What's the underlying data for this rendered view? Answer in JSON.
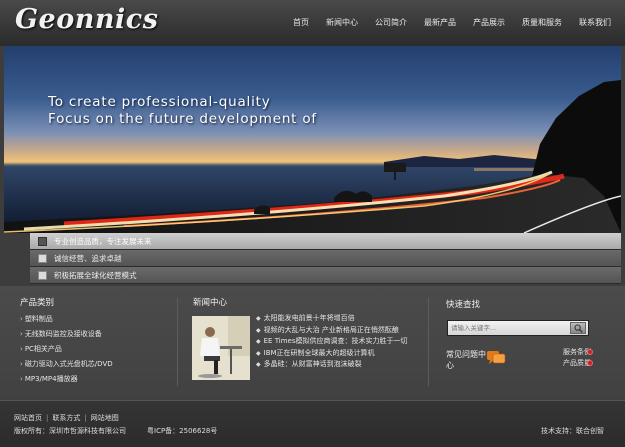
{
  "header": {
    "logo": "Geonnics",
    "nav": [
      "首页",
      "新闻中心",
      "公司简介",
      "最新产品",
      "产品展示",
      "质量和服务",
      "联系我们"
    ]
  },
  "banner": {
    "line1": "To create professional-quality",
    "line2": "Focus on the future development of"
  },
  "slogans": [
    "专业创造品质，专注发展未来",
    "诚信经营、追求卓越",
    "积极拓展全球化经营模式"
  ],
  "products": {
    "title": "产品类别",
    "items": [
      "塑料制品",
      "无线数码监控及接收设备",
      "PC相关产品",
      "磁力驱动入式光盘机芯/DVD",
      "MP3/MP4播放器"
    ]
  },
  "news": {
    "title": "新闻中心",
    "items": [
      "太阳能发电前景十年将增百倍",
      "视频的大乱与大治  产业新格局正在悄然酝酿",
      "EE Times模拟供应商调查：技术实力胜于一切",
      "IBM正在研制全球最大的超级计算机",
      "多晶硅：从财富神话到泡沫破裂"
    ]
  },
  "quick": {
    "title": "快速查找",
    "search_placeholder": "请输入关键字...",
    "faq_label": "常见问题中心",
    "links": [
      "服务条例",
      "产品质量"
    ]
  },
  "footer": {
    "links": [
      "网站首页",
      "联系方式",
      "网站地图"
    ],
    "copyright": "版权所有：深圳市哲源科技有限公司",
    "icp": "粤ICP备：2506628号",
    "tech": "技术支持：联合创智"
  },
  "colors": {
    "background": "#3d3d3d",
    "accent_dot": "#cc2222",
    "faq_icon": "#e07a1a"
  }
}
